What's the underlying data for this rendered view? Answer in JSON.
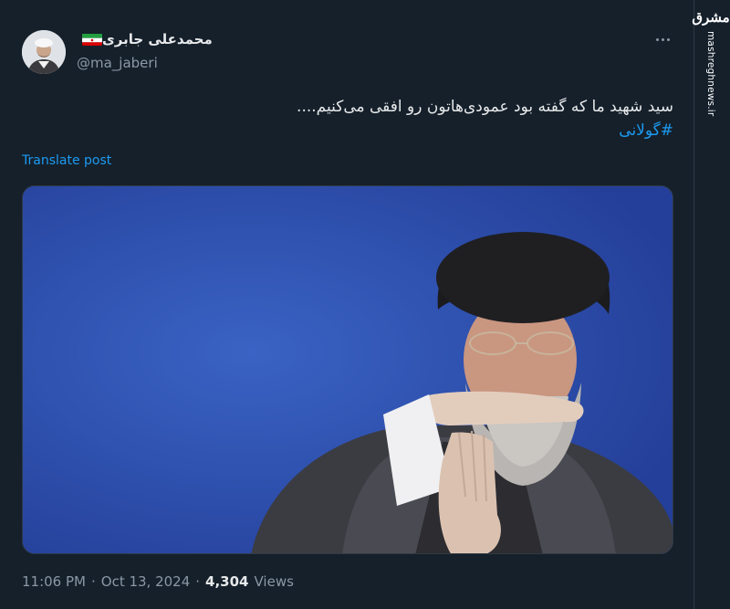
{
  "user": {
    "display_name": "محمدعلی جابری",
    "handle": "@ma_jaberi",
    "flag": "iran-flag-icon"
  },
  "post": {
    "text": "سید شهید ما که گفته بود عمودی‌هاتون رو افقی می‌کنیم....",
    "hashtag": "#گولانی",
    "translate_label": "Translate post"
  },
  "meta": {
    "time": "11:06 PM",
    "separator": "·",
    "date": "Oct 13, 2024",
    "views_count": "4,304",
    "views_label": "Views"
  },
  "watermark": {
    "logo": "مشرق",
    "url": "mashreghnews.ir"
  },
  "colors": {
    "background": "#15202b",
    "accent": "#1d9bf0",
    "muted": "#8b98a5",
    "media_bg": "#2b50b3"
  }
}
